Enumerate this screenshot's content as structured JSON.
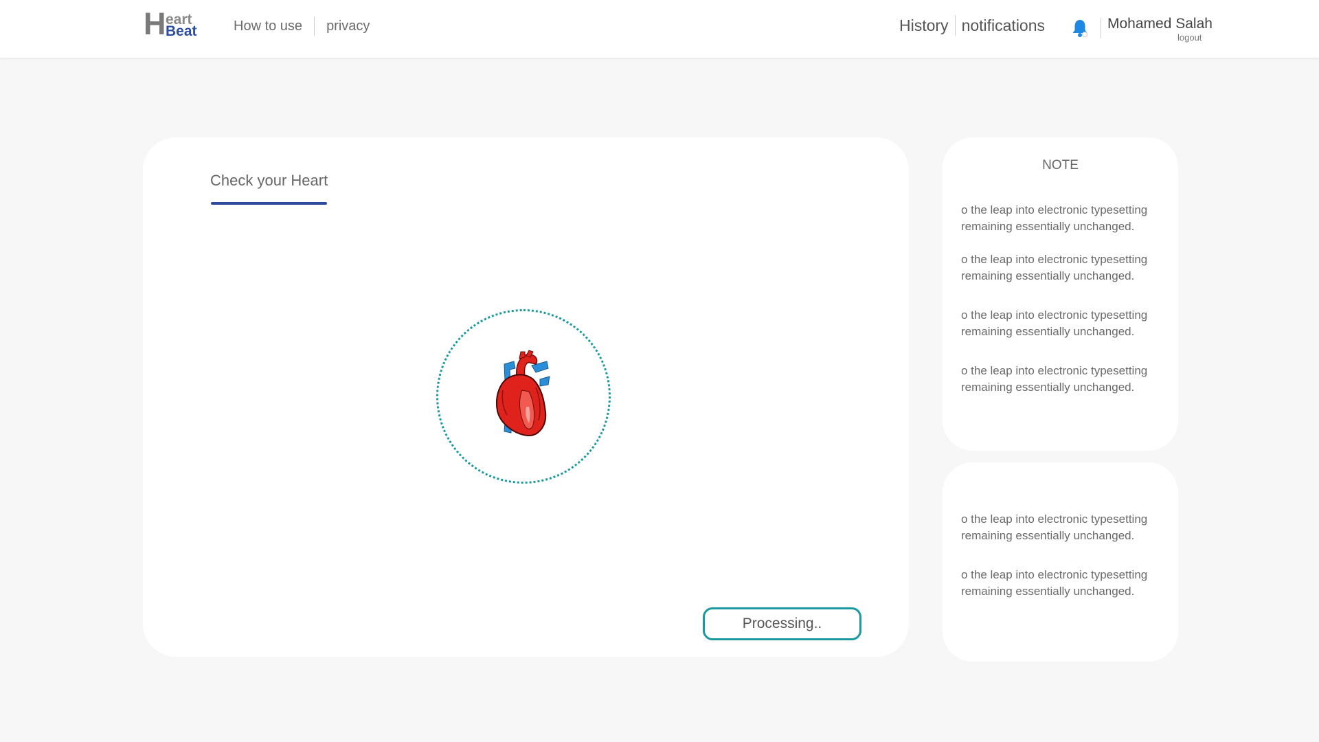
{
  "header": {
    "logo": {
      "big_letter": "H",
      "line1": "eart",
      "line2": "Beat"
    },
    "nav_left": [
      "How to use",
      "privacy"
    ],
    "nav_right": [
      "History",
      "notifications"
    ],
    "bell_icon": "bell-icon",
    "user_name": "Mohamed Salah",
    "logout_label": "logout"
  },
  "main": {
    "tab_label": "Check your Heart",
    "heart_icon": "heart-icon",
    "processing_label": "Processing..",
    "accent_color": "#1a9aa0",
    "tab_color": "#2e4b9b"
  },
  "notes": {
    "title": "NOTE",
    "card1_items": [
      "o the leap into electronic typesetting remaining essentially unchanged.",
      "o the leap into electronic typesetting remaining essentially unchanged.",
      "o the leap into electronic typesetting remaining essentially unchanged.",
      "o the leap into electronic typesetting remaining essentially unchanged."
    ],
    "card2_items": [
      "o the leap into electronic typesetting remaining essentially unchanged.",
      "o the leap into electronic typesetting remaining essentially unchanged."
    ]
  }
}
